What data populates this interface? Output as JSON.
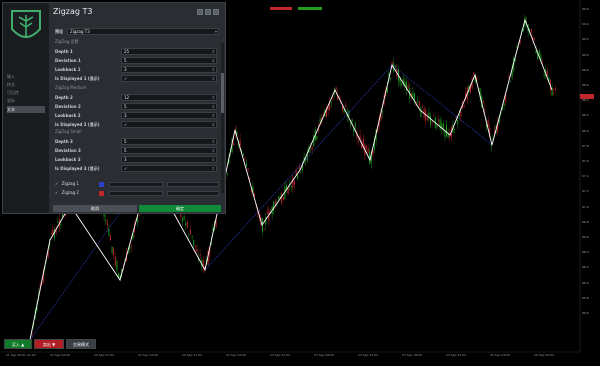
{
  "colors": {
    "up": "#1f9e1f",
    "down": "#c0262c",
    "zigzag_main": "#ffffff",
    "zigzag_alt": "#2f3fc8",
    "accent_ok": "#0f8a3a"
  },
  "dialog": {
    "title": "Zigzag T3",
    "preset_label": "预设",
    "preset_value": "Zigzag T3",
    "sidebar_items": [
      "输入",
      "样式",
      "可见性",
      "坐标",
      "文本"
    ],
    "section1": "ZigZag 设置",
    "section2": "ZigZag Medium",
    "section3": "ZigZag Small",
    "fields1": [
      {
        "label": "Depth 1",
        "value": "25"
      },
      {
        "label": "Deviation 1",
        "value": "5"
      },
      {
        "label": "Lookback 1",
        "value": "3"
      },
      {
        "label": "Is Displayed 1 (显示)",
        "value": "✓"
      }
    ],
    "fields2": [
      {
        "label": "Depth 2",
        "value": "12"
      },
      {
        "label": "Deviation 2",
        "value": "5"
      },
      {
        "label": "Lookback 2",
        "value": "3"
      },
      {
        "label": "Is Displayed 2 (显示)",
        "value": "✓"
      }
    ],
    "fields3": [
      {
        "label": "Depth 3",
        "value": "5"
      },
      {
        "label": "Deviation 3",
        "value": "5"
      },
      {
        "label": "Lookback 3",
        "value": "3"
      },
      {
        "label": "Is Displayed 3 (显示)",
        "value": "✓"
      }
    ],
    "legend": [
      {
        "label": "Zigzag 1"
      },
      {
        "label": "Zigzag 2"
      }
    ],
    "cancel_label": "取消",
    "ok_label": "确定"
  },
  "bottom_buttons": {
    "buy": "买入 ▲",
    "sell": "卖出 ▼",
    "extra": "交易模式"
  },
  "price_axis": [
    "99.6",
    "99.4",
    "99.2",
    "99.0",
    "98.8",
    "98.6",
    "98.4",
    "98.2",
    "98.0",
    "97.8",
    "97.6",
    "97.4",
    "97.2",
    "97.0",
    "96.8",
    "96.6",
    "96.4",
    "96.2",
    "96.0",
    "95.8",
    "95.6"
  ],
  "time_axis": [
    "21 Sep 2016, 21:00",
    "22 Sep 02:00",
    "22 Sep 07:00",
    "22 Sep 12:00",
    "22 Sep 17:00",
    "22 Sep 22:00",
    "23 Sep 03:00",
    "23 Sep 08:00",
    "23 Sep 13:00",
    "23 Sep 18:00",
    "23 Sep 23:00",
    "26 Sep 04:00",
    "26 Sep 09:00"
  ]
}
